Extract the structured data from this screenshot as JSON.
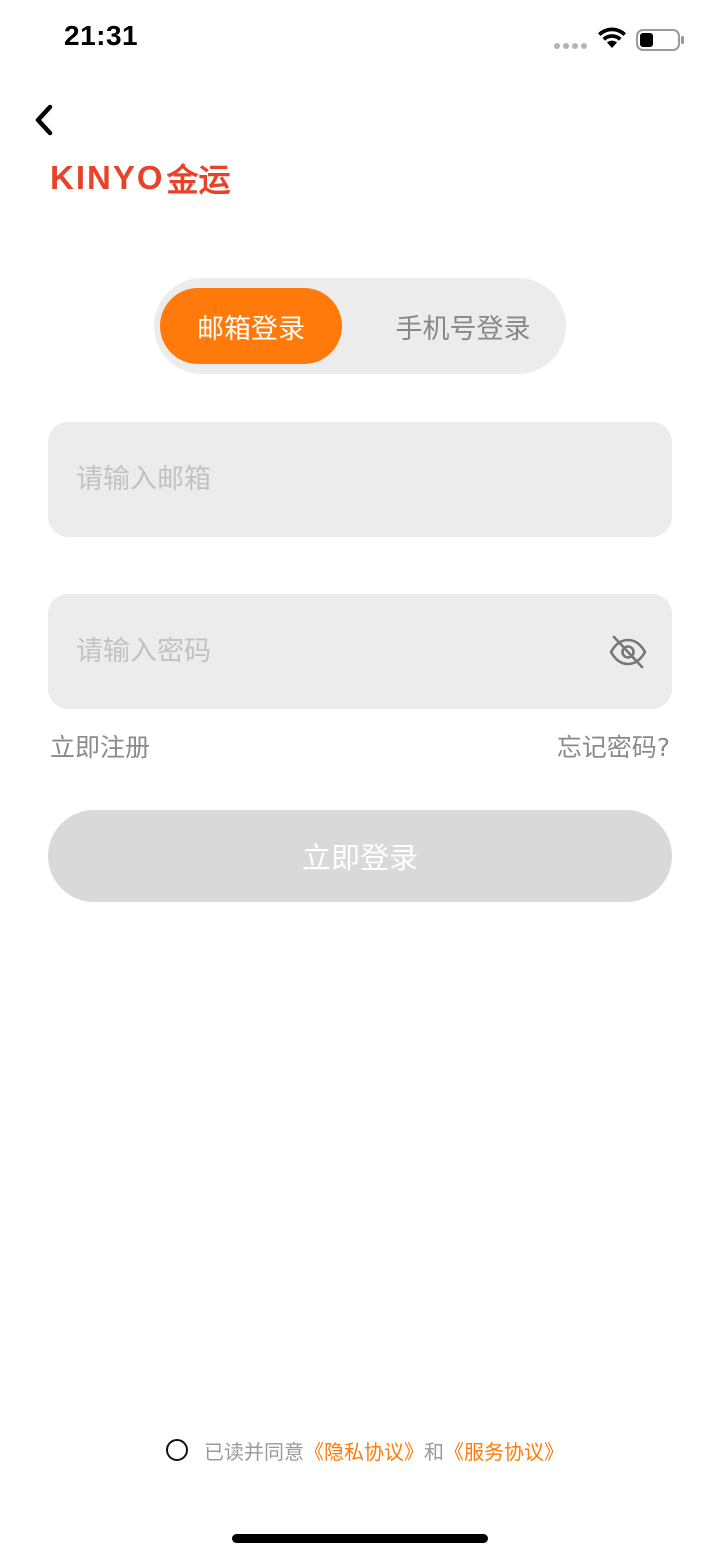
{
  "status_bar": {
    "time": "21:31",
    "icons": [
      "signal-dots-icon",
      "wifi-icon",
      "battery-icon"
    ]
  },
  "header": {
    "back_icon": "chevron-left-icon"
  },
  "logo": {
    "latin": "KINYO",
    "cjk": "金运",
    "color": "#e8432a"
  },
  "tabs": [
    {
      "label": "邮箱登录",
      "active": true
    },
    {
      "label": "手机号登录",
      "active": false
    }
  ],
  "form": {
    "email_placeholder": "请输入邮箱",
    "email_value": "",
    "password_placeholder": "请输入密码",
    "password_value": "",
    "password_toggle_icon": "eye-off-icon",
    "register_link": "立即注册",
    "forgot_link": "忘记密码?",
    "submit_label": "立即登录"
  },
  "agreement": {
    "prefix": "已读并同意",
    "privacy": "《隐私协议》",
    "and": "和",
    "service": "《服务协议》",
    "checked": false
  },
  "colors": {
    "accent": "#ff7a0b",
    "input_bg": "#ececec",
    "button_disabled": "#d9d9d9"
  }
}
